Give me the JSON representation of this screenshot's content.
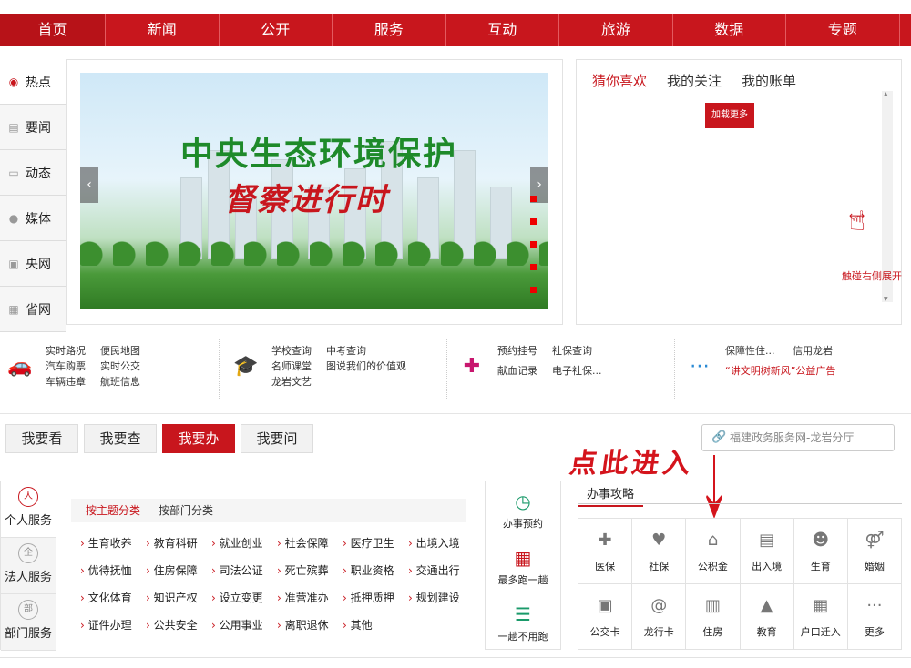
{
  "nav": [
    "首页",
    "新闻",
    "公开",
    "服务",
    "互动",
    "旅游",
    "数据",
    "专题"
  ],
  "hot_side": [
    {
      "label": "热点",
      "icon": "broadcast-icon"
    },
    {
      "label": "要闻",
      "icon": "news-icon"
    },
    {
      "label": "动态",
      "icon": "monitor-icon"
    },
    {
      "label": "媒体",
      "icon": "microphone-icon"
    },
    {
      "label": "央网",
      "icon": "document-icon"
    },
    {
      "label": "省网",
      "icon": "news-grid-icon"
    }
  ],
  "banner": {
    "title_line1": "中央生态环境保护",
    "title_line2": "督察进行时",
    "prev": "‹",
    "next": "›"
  },
  "right_panel": {
    "tabs": [
      "猜你喜欢",
      "我的关注",
      "我的账单"
    ],
    "load_more": "加载更多",
    "touch_hint": "触碰右侧展开"
  },
  "services": [
    {
      "icon": "car-icon",
      "links": [
        "实时路况",
        "便民地图",
        "汽车购票",
        "实时公交",
        "车辆违章",
        "航班信息"
      ]
    },
    {
      "icon": "graduation-cap-icon",
      "links": [
        "学校查询",
        "中考查询",
        "名师课堂",
        "图说我们的价值观",
        "龙岩文艺",
        ""
      ]
    },
    {
      "icon": "medical-kit-icon",
      "links": [
        "预约挂号",
        "社保查询",
        "献血记录",
        "电子社保..."
      ]
    },
    {
      "icon": "more-circle-icon",
      "links": [
        "保障性住...",
        "信用龙岩",
        "“讲文明树新风”公益广告"
      ]
    }
  ],
  "action_tabs": [
    "我要看",
    "我要查",
    "我要办",
    "我要问"
  ],
  "search_placeholder": "福建政务服务网-龙岩分厅",
  "callout": "点此进入",
  "categories": [
    "个人服务",
    "法人服务",
    "部门服务"
  ],
  "sub_tabs": [
    "按主题分类",
    "按部门分类"
  ],
  "topics": [
    "生育收养",
    "教育科研",
    "就业创业",
    "社会保障",
    "医疗卫生",
    "出境入境",
    "优待抚恤",
    "住房保障",
    "司法公证",
    "死亡殡葬",
    "职业资格",
    "交通出行",
    "文化体育",
    "知识产权",
    "设立变更",
    "准营准办",
    "抵押质押",
    "规划建设",
    "证件办理",
    "公共安全",
    "公用事业",
    "离职退休",
    "其他"
  ],
  "mid_col": [
    {
      "label": "办事预约",
      "icon": "calendar-clock-icon"
    },
    {
      "label": "最多跑一趟",
      "icon": "calendar-check-icon"
    },
    {
      "label": "一趟不用跑",
      "icon": "checklist-icon"
    }
  ],
  "guide_title": "办事攻略",
  "guide_items": [
    {
      "label": "医保",
      "icon": "medical-bag-icon"
    },
    {
      "label": "社保",
      "icon": "heart-hands-icon"
    },
    {
      "label": "公积金",
      "icon": "house-icon"
    },
    {
      "label": "出入境",
      "icon": "id-card-icon"
    },
    {
      "label": "生育",
      "icon": "baby-icon"
    },
    {
      "label": "婚姻",
      "icon": "gender-icon"
    },
    {
      "label": "公交卡",
      "icon": "bus-icon"
    },
    {
      "label": "龙行卡",
      "icon": "swirl-icon"
    },
    {
      "label": "住房",
      "icon": "building-icon"
    },
    {
      "label": "教育",
      "icon": "graduation-cap-icon"
    },
    {
      "label": "户口迁入",
      "icon": "register-icon"
    },
    {
      "label": "更多",
      "icon": "ellipsis-icon"
    }
  ]
}
